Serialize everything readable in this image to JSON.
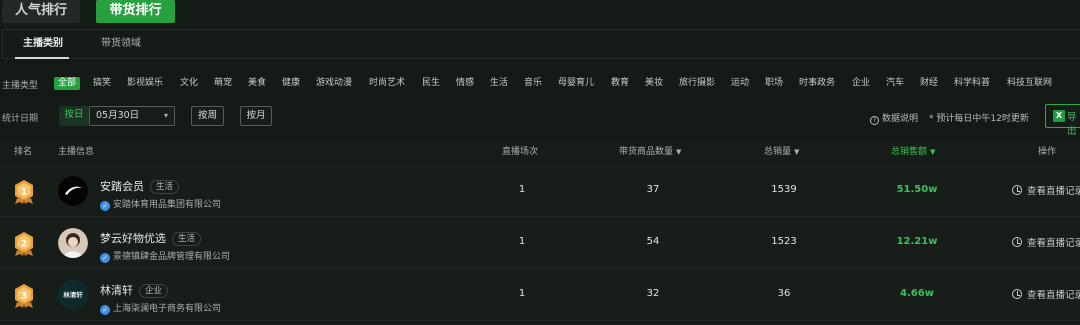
{
  "top_tabs": [
    "人气排行",
    "带货排行"
  ],
  "sub_tabs": [
    "主播类别",
    "带货领域"
  ],
  "filters": {
    "category_label": "主播类型",
    "categories": [
      "全部",
      "搞笑",
      "影视娱乐",
      "文化",
      "萌宠",
      "美食",
      "健康",
      "游戏动漫",
      "时尚艺术",
      "民生",
      "情感",
      "生活",
      "音乐",
      "母婴育儿",
      "教育",
      "美妆",
      "旅行摄影",
      "运动",
      "职场",
      "时事政务",
      "企业",
      "汽车",
      "财经",
      "科学科普",
      "科技互联网"
    ],
    "active_category": "全部",
    "date_label": "统计日期",
    "day_button": "按日",
    "date_value": "05月30日",
    "week_button": "按周",
    "month_button": "按月",
    "data_info": "数据说明",
    "update_note": "* 预计每日中午12时更新",
    "export_label": "导出",
    "export_icon": "X"
  },
  "table": {
    "headers": {
      "rank": "排名",
      "anchor": "主播信息",
      "sessions": "直播场次",
      "goods_count": "带货商品数量",
      "sales_volume": "总销量",
      "gmv": "总销售额",
      "action": "操作"
    },
    "rows": [
      {
        "rank": "1",
        "name": "安踏会员",
        "tag": "生活",
        "company": "安踏体育用品集团有限公司",
        "sessions": "1",
        "goods_count": "37",
        "sales_volume": "1539",
        "gmv": "51.50w",
        "action": "查看直播记录"
      },
      {
        "rank": "2",
        "name": "梦云好物优选",
        "tag": "生活",
        "company": "景德镇肆金品牌管理有限公司",
        "sessions": "1",
        "goods_count": "54",
        "sales_volume": "1523",
        "gmv": "12.21w",
        "action": "查看直播记录"
      },
      {
        "rank": "3",
        "name": "林清轩",
        "tag": "企业",
        "company": "上海柒澜电子商务有限公司",
        "sessions": "1",
        "goods_count": "32",
        "sales_volume": "36",
        "gmv": "4.66w",
        "action": "查看直播记录"
      }
    ],
    "avatar_3_text": "林清轩"
  },
  "colors": {
    "accent": "#27a040",
    "gmv": "#3cc05a",
    "medal": "#e8a33b"
  }
}
